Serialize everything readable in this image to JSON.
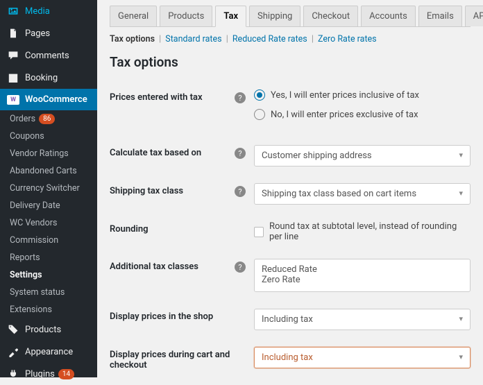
{
  "sidebar": {
    "items": [
      {
        "label": "Media"
      },
      {
        "label": "Pages"
      },
      {
        "label": "Comments"
      },
      {
        "label": "Booking"
      },
      {
        "label": "WooCommerce"
      },
      {
        "label": "Products"
      },
      {
        "label": "Appearance"
      },
      {
        "label": "Plugins",
        "badge": "14"
      }
    ],
    "sub": [
      {
        "label": "Orders",
        "badge": "86"
      },
      {
        "label": "Coupons"
      },
      {
        "label": "Vendor Ratings"
      },
      {
        "label": "Abandoned Carts"
      },
      {
        "label": "Currency Switcher"
      },
      {
        "label": "Delivery Date"
      },
      {
        "label": "WC Vendors"
      },
      {
        "label": "Commission"
      },
      {
        "label": "Reports"
      },
      {
        "label": "Settings"
      },
      {
        "label": "System status"
      },
      {
        "label": "Extensions"
      }
    ]
  },
  "tabs": [
    "General",
    "Products",
    "Tax",
    "Shipping",
    "Checkout",
    "Accounts",
    "Emails",
    "API"
  ],
  "subnav": {
    "current": "Tax options",
    "links": [
      "Standard rates",
      "Reduced Rate rates",
      "Zero Rate rates"
    ]
  },
  "heading": "Tax options",
  "help_glyph": "?",
  "form": {
    "prices_entered": {
      "label": "Prices entered with tax",
      "opt1": "Yes, I will enter prices inclusive of tax",
      "opt2": "No, I will enter prices exclusive of tax"
    },
    "calc_based": {
      "label": "Calculate tax based on",
      "value": "Customer shipping address"
    },
    "ship_class": {
      "label": "Shipping tax class",
      "value": "Shipping tax class based on cart items"
    },
    "rounding": {
      "label": "Rounding",
      "text": "Round tax at subtotal level, instead of rounding per line"
    },
    "add_classes": {
      "label": "Additional tax classes",
      "value": "Reduced Rate\nZero Rate"
    },
    "display_shop": {
      "label": "Display prices in the shop",
      "value": "Including tax"
    },
    "display_cart": {
      "label": "Display prices during cart and checkout",
      "value": "Including tax"
    }
  }
}
